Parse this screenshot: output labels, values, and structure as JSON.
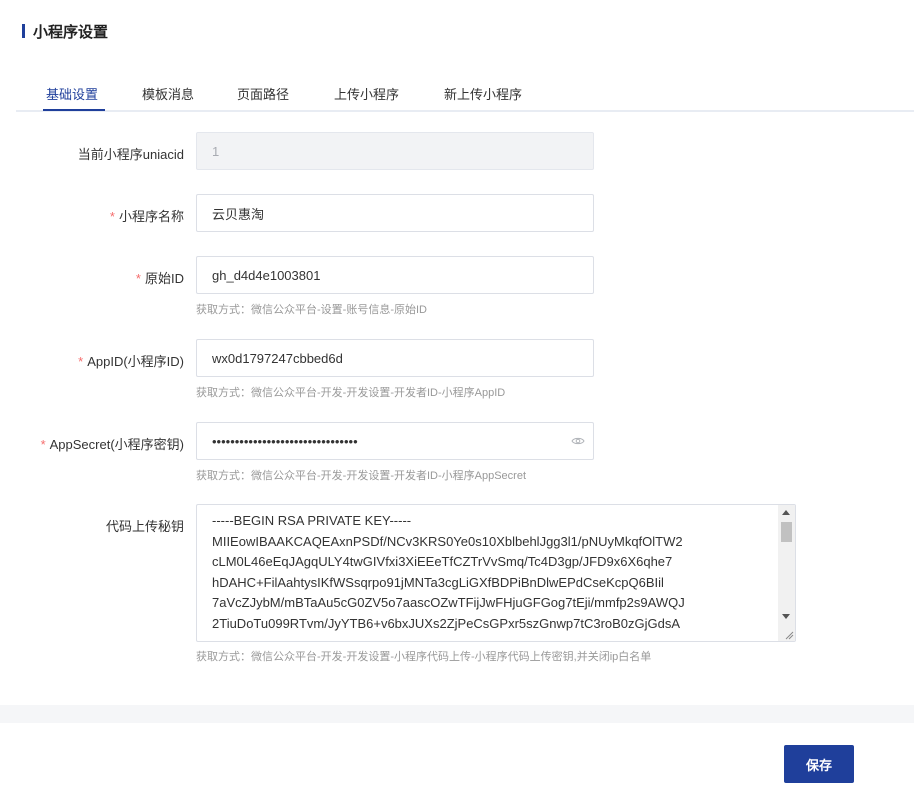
{
  "page": {
    "title": "小程序设置"
  },
  "tabs": [
    {
      "label": "基础设置",
      "active": true
    },
    {
      "label": "模板消息",
      "active": false
    },
    {
      "label": "页面路径",
      "active": false
    },
    {
      "label": "上传小程序",
      "active": false
    },
    {
      "label": "新上传小程序",
      "active": false
    }
  ],
  "form": {
    "uniacid": {
      "label": "当前小程序uniacid",
      "value": "1"
    },
    "name": {
      "required": "*",
      "label": "小程序名称",
      "value": "云贝惠淘"
    },
    "original_id": {
      "required": "*",
      "label": "原始ID",
      "value": "gh_d4d4e1003801",
      "hint": "获取方式：微信公众平台-设置-账号信息-原始ID"
    },
    "app_id": {
      "required": "*",
      "label": "AppID(小程序ID)",
      "value": "wx0d1797247cbbed6d",
      "hint": "获取方式：微信公众平台-开发-开发设置-开发者ID-小程序AppID"
    },
    "app_secret": {
      "required": "*",
      "label": "AppSecret(小程序密钥)",
      "value": "••••••••••••••••••••••••••••••••",
      "hint": "获取方式：微信公众平台-开发-开发设置-开发者ID-小程序AppSecret",
      "icon": "eye-icon"
    },
    "upload_key": {
      "label": "代码上传秘钥",
      "value": "-----BEGIN RSA PRIVATE KEY-----\nMIIEowIBAAKCAQEAxnPSDf/NCv3KRS0Ye0s10XblbehlJgg3l1/pNUyMkqfOlTW2\ncLM0L46eEqJAgqULY4twGIVfxi3XiEEeTfCZTrVvSmq/Tc4D3gp/JFD9x6X6qhe7\nhDAHC+FilAahtysIKfWSsqrpo91jMNTa3cgLiGXfBDPiBnDlwEPdCseKcpQ6BIil\n7aVcZJybM/mBTaAu5cG0ZV5o7aascOZwTFijJwFHjuGFGog7tEji/mmfp2s9AWQJ\n2TiuDoTu099RTvm/JyYTB6+v6bxJUXs2ZjPeCsGPxr5szGnwp7tC3roB0zGjGdsA",
      "hint": "获取方式：微信公众平台-开发-开发设置-小程序代码上传-小程序代码上传密钥,并关闭ip白名单"
    }
  },
  "footer": {
    "save_label": "保存"
  },
  "colors": {
    "accent": "#1f3f9b",
    "required": "#f56c6c",
    "hint": "#999999"
  }
}
